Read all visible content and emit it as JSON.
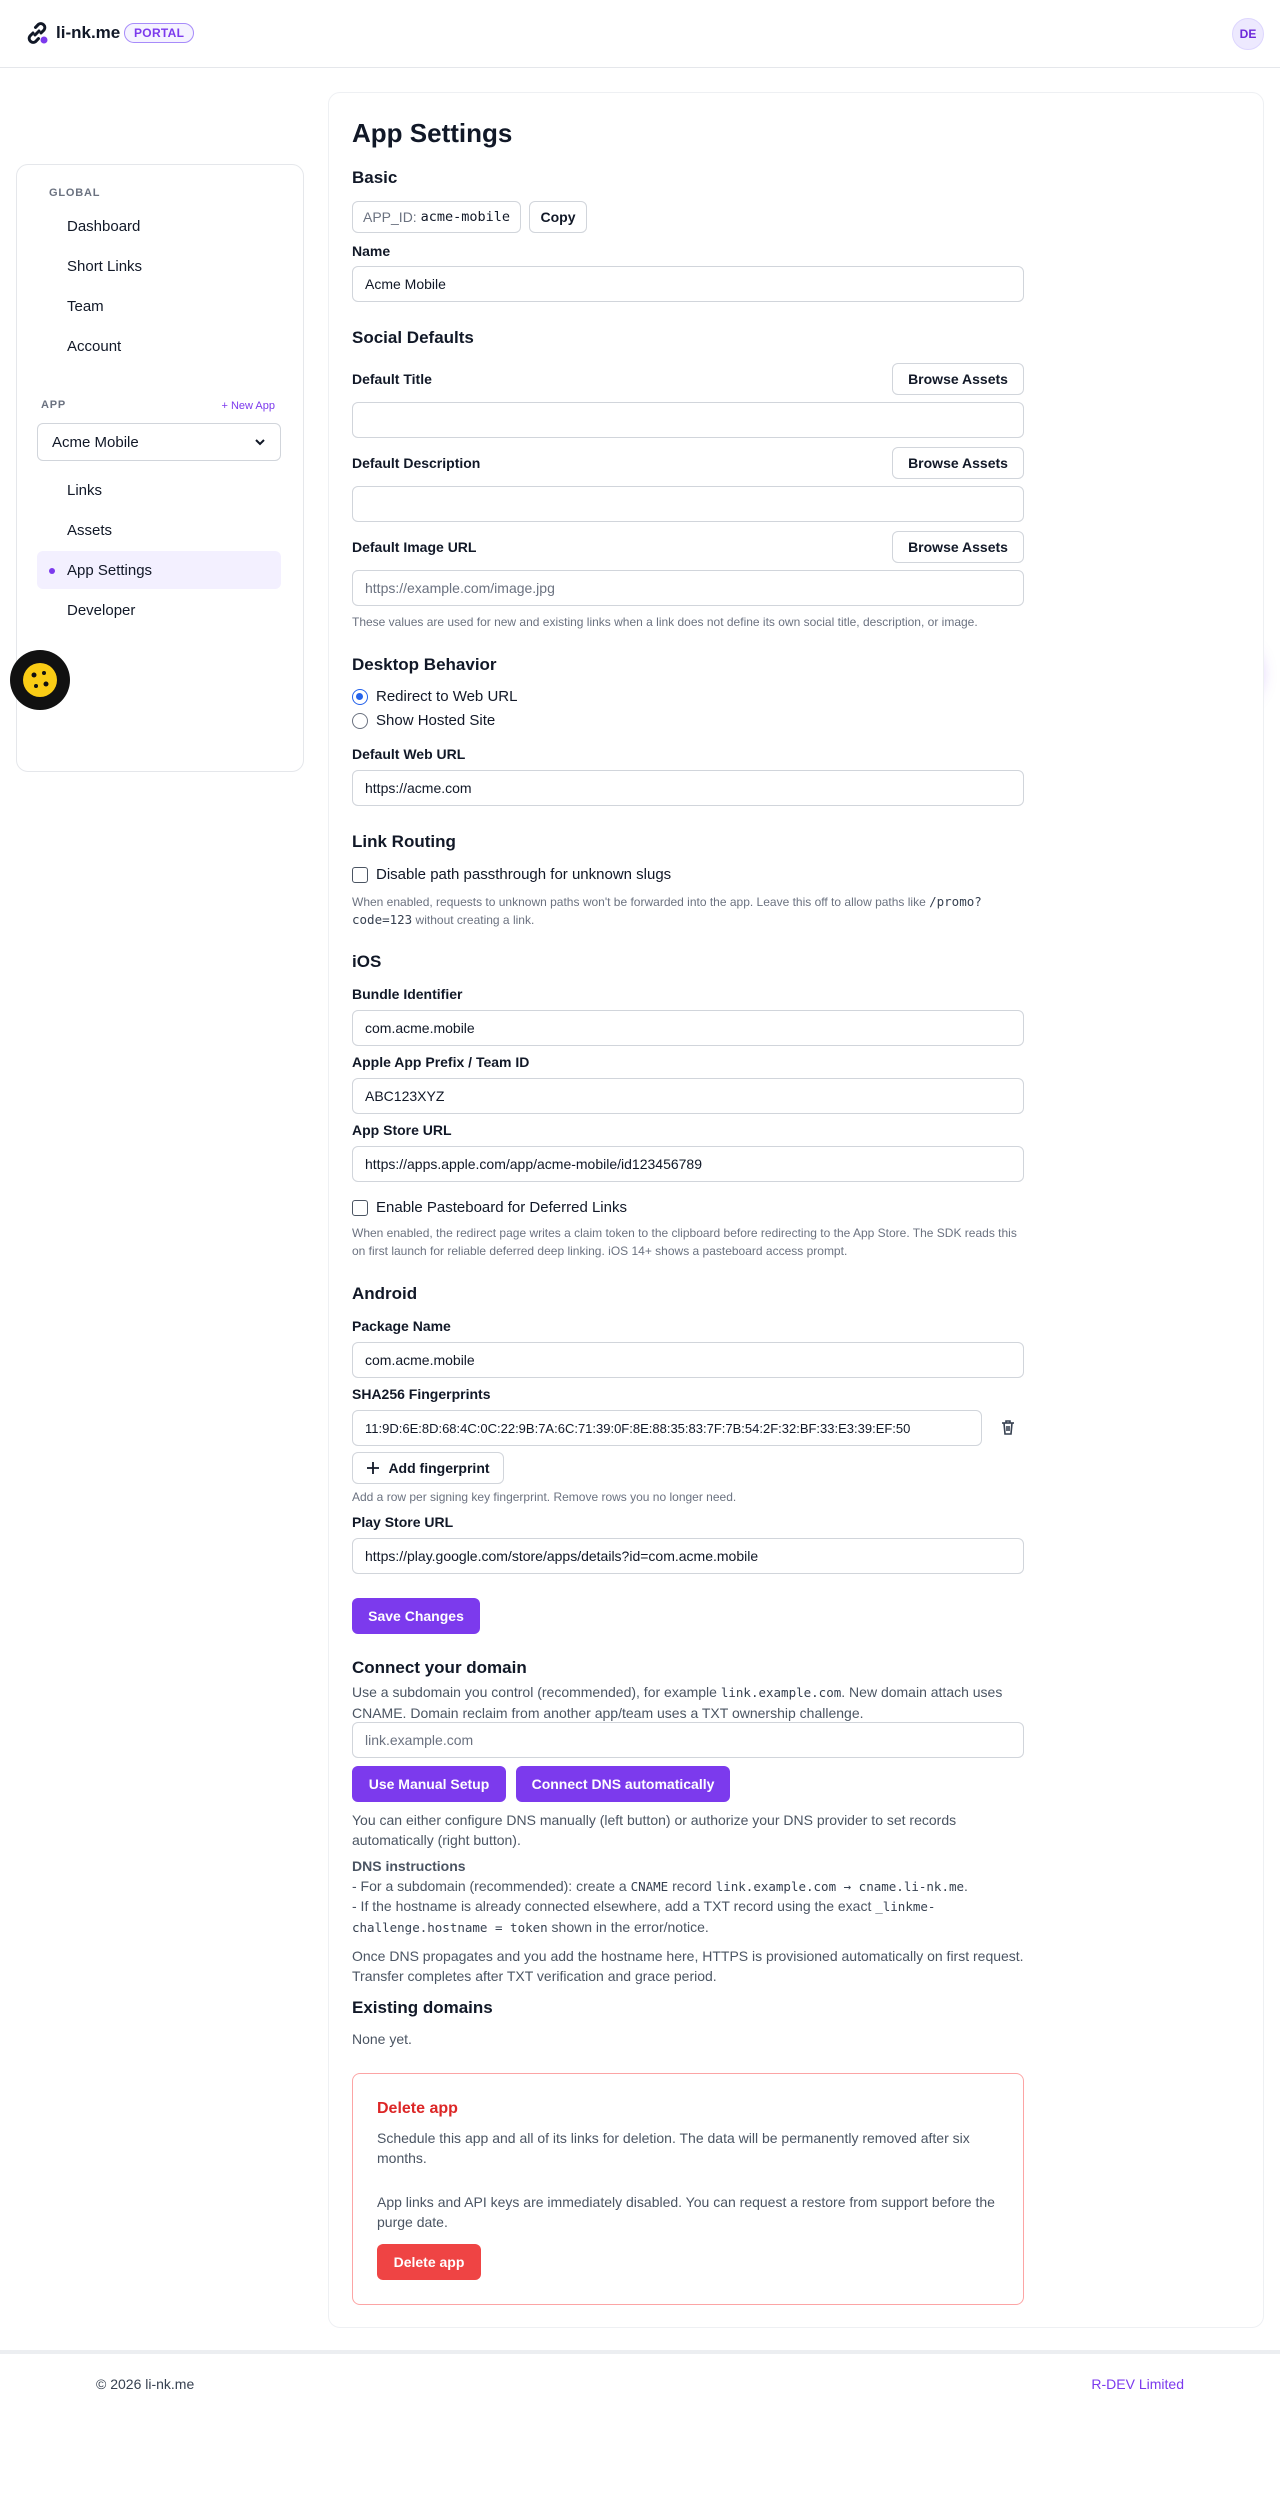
{
  "header": {
    "logo_text": "li-nk.me",
    "badge": "PORTAL",
    "avatar_initials": "DE"
  },
  "sidebar": {
    "global_label": "GLOBAL",
    "global_items": [
      {
        "label": "Dashboard"
      },
      {
        "label": "Short Links"
      },
      {
        "label": "Team"
      },
      {
        "label": "Account"
      }
    ],
    "app_label": "APP",
    "new_app": "+ New App",
    "app_select_value": "Acme Mobile",
    "app_items": [
      {
        "label": "Links"
      },
      {
        "label": "Assets"
      },
      {
        "label": "App Settings",
        "active": true
      },
      {
        "label": "Developer"
      }
    ]
  },
  "page": {
    "title": "App Settings",
    "basic": {
      "title": "Basic",
      "app_id_key": "APP_ID:",
      "app_id_value": "acme-mobile",
      "copy_label": "Copy",
      "name_label": "Name",
      "name_value": "Acme Mobile"
    },
    "social": {
      "title": "Social Defaults",
      "default_title_label": "Default Title",
      "default_description_label": "Default Description",
      "default_image_label": "Default Image URL",
      "browse_label": "Browse Assets",
      "image_placeholder": "https://example.com/image.jpg",
      "help": "These values are used for new and existing links when a link does not define its own social title, description, or image."
    },
    "desktop": {
      "title": "Desktop Behavior",
      "option_redirect": "Redirect to Web URL",
      "option_hosted": "Show Hosted Site",
      "web_url_label": "Default Web URL",
      "web_url_value": "https://acme.com"
    },
    "routing": {
      "title": "Link Routing",
      "checkbox_label": "Disable path passthrough for unknown slugs",
      "help_before": "When enabled, requests to unknown paths won't be forwarded into the app. Leave this off to allow paths like ",
      "help_code": "/promo?code=123",
      "help_after": " without creating a link."
    },
    "ios": {
      "title": "iOS",
      "bundle_label": "Bundle Identifier",
      "bundle_value": "com.acme.mobile",
      "team_label": "Apple App Prefix / Team ID",
      "team_value": "ABC123XYZ",
      "store_label": "App Store URL",
      "store_value": "https://apps.apple.com/app/acme-mobile/id123456789",
      "pasteboard_label": "Enable Pasteboard for Deferred Links",
      "pasteboard_help": "When enabled, the redirect page writes a claim token to the clipboard before redirecting to the App Store. The SDK reads this on first launch for reliable deferred deep linking. iOS 14+ shows a pasteboard access prompt."
    },
    "android": {
      "title": "Android",
      "package_label": "Package Name",
      "package_value": "com.acme.mobile",
      "sha_label": "SHA256 Fingerprints",
      "sha_value": "11:9D:6E:8D:68:4C:0C:22:9B:7A:6C:71:39:0F:8E:88:35:83:7F:7B:54:2F:32:BF:33:E3:39:EF:50",
      "add_fingerprint": "Add fingerprint",
      "fingerprint_help": "Add a row per signing key fingerprint. Remove rows you no longer need.",
      "play_label": "Play Store URL",
      "play_value": "https://play.google.com/store/apps/details?id=com.acme.mobile"
    },
    "save_label": "Save Changes",
    "domain": {
      "title": "Connect your domain",
      "intro_1": "Use a subdomain you control (recommended), for example ",
      "intro_code": "link.example.com",
      "intro_2": ". New domain attach uses CNAME. Domain reclaim from another app/team uses a TXT ownership challenge.",
      "placeholder": "link.example.com",
      "manual_btn": "Use Manual Setup",
      "auto_btn": "Connect DNS automatically",
      "either_text": "You can either configure DNS manually (left button) or authorize your DNS provider to set records automatically (right button).",
      "instructions_title": "DNS instructions",
      "line1_a": "- For a subdomain (recommended): create a ",
      "line1_code1": "CNAME",
      "line1_b": " record ",
      "line1_code2": "link.example.com → cname.li-nk.me",
      "line1_c": ".",
      "line2_a": "- If the hostname is already connected elsewhere, add a TXT record using the exact ",
      "line2_code": "_linkme-challenge.hostname = token",
      "line2_b": " shown in the error/notice.",
      "propagate_text": "Once DNS propagates and you add the hostname here, HTTPS is provisioned automatically on first request. Transfer completes after TXT verification and grace period.",
      "existing_title": "Existing domains",
      "existing_value": "None yet."
    },
    "danger": {
      "title": "Delete app",
      "text1": "Schedule this app and all of its links for deletion. The data will be permanently removed after six months.",
      "text2": "App links and API keys are immediately disabled. You can request a restore from support before the purge date.",
      "button": "Delete app"
    }
  },
  "footer": {
    "copyright": "© 2026 li-nk.me",
    "company": "R-DEV Limited"
  }
}
